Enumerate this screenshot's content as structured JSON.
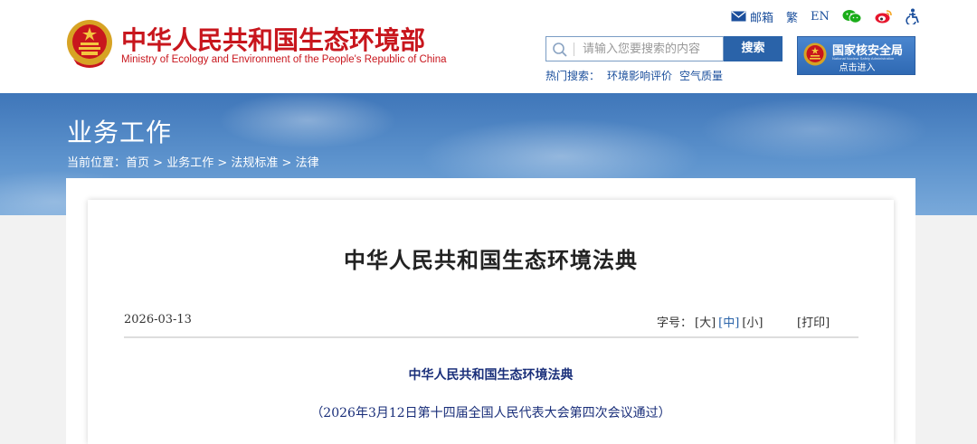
{
  "header": {
    "logo_cn": "中华人民共和国生态环境部",
    "logo_en": "Ministry of Ecology and Environment of the People's Republic of China",
    "top_links": {
      "mail": "邮箱",
      "traditional": "繁",
      "english": "EN"
    },
    "search": {
      "placeholder": "请输入您要搜索的内容",
      "button": "搜索"
    },
    "hot_search": {
      "label": "热门搜索：",
      "items": [
        "环境影响评价",
        "空气质量"
      ]
    },
    "nnsa": {
      "title": "国家核安全局",
      "subtitle": "National Nuclear Safety Administration",
      "enter": "点击进入"
    }
  },
  "banner": {
    "title": "业务工作",
    "breadcrumb_label": "当前位置：",
    "crumbs": [
      "首页",
      "业务工作",
      "法规标准",
      "法律"
    ],
    "separator": " > "
  },
  "article": {
    "title": "中华人民共和国生态环境法典",
    "date": "2026-03-13",
    "font_size_label": "字号：",
    "font_sizes": [
      "[大]",
      "[中]",
      "[小]"
    ],
    "print": "[打印]",
    "subtitle": "中华人民共和国生态环境法典",
    "adoption": "（2026年3月12日第十四届全国人民代表大会第四次会议通过）"
  },
  "colors": {
    "brand_red": "#c8161d",
    "link_blue": "#1b4f9c",
    "button_blue": "#2a63a9",
    "text_navy": "#1a2f7a"
  }
}
